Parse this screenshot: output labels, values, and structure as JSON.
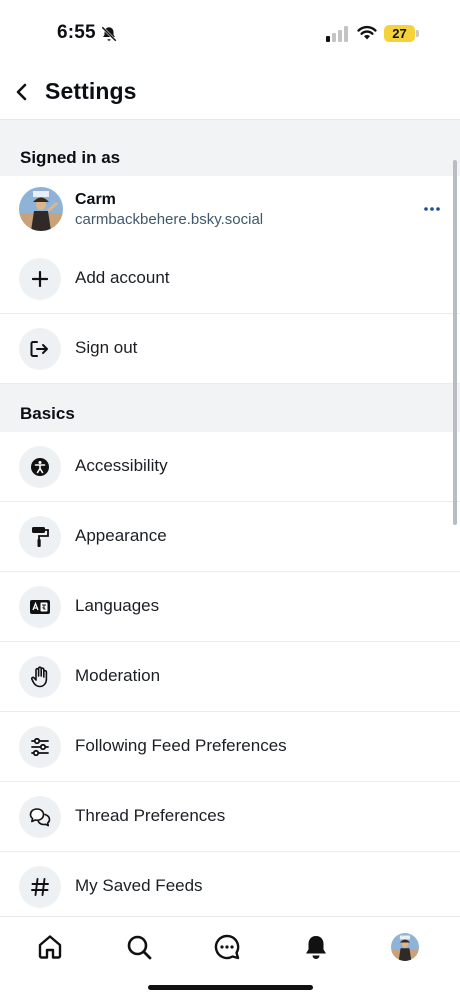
{
  "status_bar": {
    "time": "6:55",
    "battery": "27",
    "battery_color": "#f6d23a"
  },
  "header": {
    "title": "Settings"
  },
  "signed_in_section": {
    "title": "Signed in as",
    "account": {
      "name": "Carm",
      "handle": "carmbackbehere.bsky.social"
    },
    "add_account_label": "Add account",
    "sign_out_label": "Sign out"
  },
  "basics_section": {
    "title": "Basics",
    "items": [
      {
        "label": "Accessibility",
        "icon": "accessibility-icon"
      },
      {
        "label": "Appearance",
        "icon": "paint-roller-icon"
      },
      {
        "label": "Languages",
        "icon": "languages-icon"
      },
      {
        "label": "Moderation",
        "icon": "hand-icon"
      },
      {
        "label": "Following Feed Preferences",
        "icon": "sliders-icon"
      },
      {
        "label": "Thread Preferences",
        "icon": "chat-bubbles-icon"
      },
      {
        "label": "My Saved Feeds",
        "icon": "hashtag-icon"
      }
    ]
  },
  "tab_bar": {
    "tabs": [
      "home-icon",
      "search-icon",
      "messages-icon",
      "notifications-icon",
      "profile-avatar"
    ]
  },
  "colors": {
    "accent": "#1d64d8",
    "section_bg": "#f1f3f5",
    "icon_circle_bg": "#eef1f4"
  }
}
